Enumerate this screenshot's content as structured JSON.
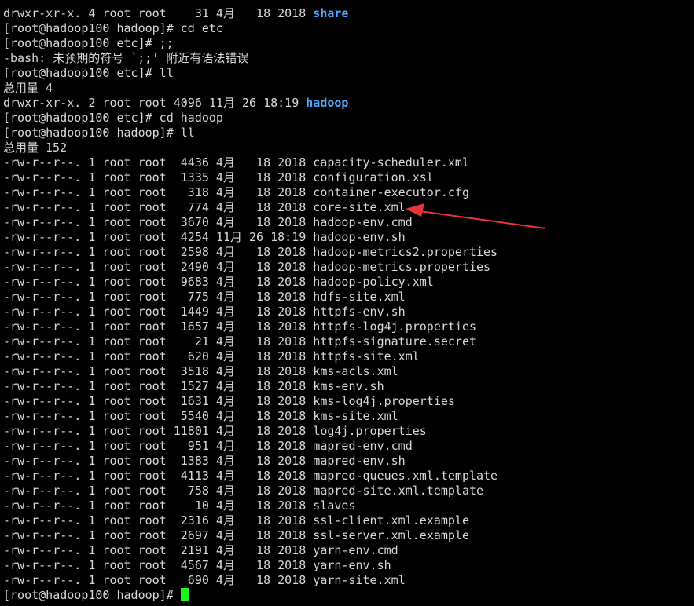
{
  "terminal": {
    "lines_before": [
      {
        "text": "drwxr-xr-x. 4 root root    31 4月   18 2018 ",
        "dir": "share"
      },
      {
        "text": "[root@hadoop100 hadoop]# cd etc"
      },
      {
        "text": "[root@hadoop100 etc]# ;;"
      },
      {
        "text": "-bash: 未预期的符号 `;;' 附近有语法错误"
      },
      {
        "text": "[root@hadoop100 etc]# ll"
      },
      {
        "text": "总用量 4"
      },
      {
        "text": "drwxr-xr-x. 2 root root 4096 11月 26 18:19 ",
        "dir": "hadoop"
      },
      {
        "text": "[root@hadoop100 etc]# cd hadoop"
      },
      {
        "text": "[root@hadoop100 hadoop]# ll"
      },
      {
        "text": "总用量 152"
      }
    ],
    "files": [
      "-rw-r--r--. 1 root root  4436 4月   18 2018 capacity-scheduler.xml",
      "-rw-r--r--. 1 root root  1335 4月   18 2018 configuration.xsl",
      "-rw-r--r--. 1 root root   318 4月   18 2018 container-executor.cfg",
      "-rw-r--r--. 1 root root   774 4月   18 2018 core-site.xml",
      "-rw-r--r--. 1 root root  3670 4月   18 2018 hadoop-env.cmd",
      "-rw-r--r--. 1 root root  4254 11月 26 18:19 hadoop-env.sh",
      "-rw-r--r--. 1 root root  2598 4月   18 2018 hadoop-metrics2.properties",
      "-rw-r--r--. 1 root root  2490 4月   18 2018 hadoop-metrics.properties",
      "-rw-r--r--. 1 root root  9683 4月   18 2018 hadoop-policy.xml",
      "-rw-r--r--. 1 root root   775 4月   18 2018 hdfs-site.xml",
      "-rw-r--r--. 1 root root  1449 4月   18 2018 httpfs-env.sh",
      "-rw-r--r--. 1 root root  1657 4月   18 2018 httpfs-log4j.properties",
      "-rw-r--r--. 1 root root    21 4月   18 2018 httpfs-signature.secret",
      "-rw-r--r--. 1 root root   620 4月   18 2018 httpfs-site.xml",
      "-rw-r--r--. 1 root root  3518 4月   18 2018 kms-acls.xml",
      "-rw-r--r--. 1 root root  1527 4月   18 2018 kms-env.sh",
      "-rw-r--r--. 1 root root  1631 4月   18 2018 kms-log4j.properties",
      "-rw-r--r--. 1 root root  5540 4月   18 2018 kms-site.xml",
      "-rw-r--r--. 1 root root 11801 4月   18 2018 log4j.properties",
      "-rw-r--r--. 1 root root   951 4月   18 2018 mapred-env.cmd",
      "-rw-r--r--. 1 root root  1383 4月   18 2018 mapred-env.sh",
      "-rw-r--r--. 1 root root  4113 4月   18 2018 mapred-queues.xml.template",
      "-rw-r--r--. 1 root root   758 4月   18 2018 mapred-site.xml.template",
      "-rw-r--r--. 1 root root    10 4月   18 2018 slaves",
      "-rw-r--r--. 1 root root  2316 4月   18 2018 ssl-client.xml.example",
      "-rw-r--r--. 1 root root  2697 4月   18 2018 ssl-server.xml.example",
      "-rw-r--r--. 1 root root  2191 4月   18 2018 yarn-env.cmd",
      "-rw-r--r--. 1 root root  4567 4月   18 2018 yarn-env.sh",
      "-rw-r--r--. 1 root root   690 4月   18 2018 yarn-site.xml"
    ],
    "prompt": "[root@hadoop100 hadoop]# ",
    "highlighted_file": "core-site.xml"
  },
  "colors": {
    "background": "#000000",
    "text": "#d8d8d8",
    "directory": "#4fa9ff",
    "cursor": "#1cf51c",
    "annotation_arrow": "#e8333a"
  }
}
